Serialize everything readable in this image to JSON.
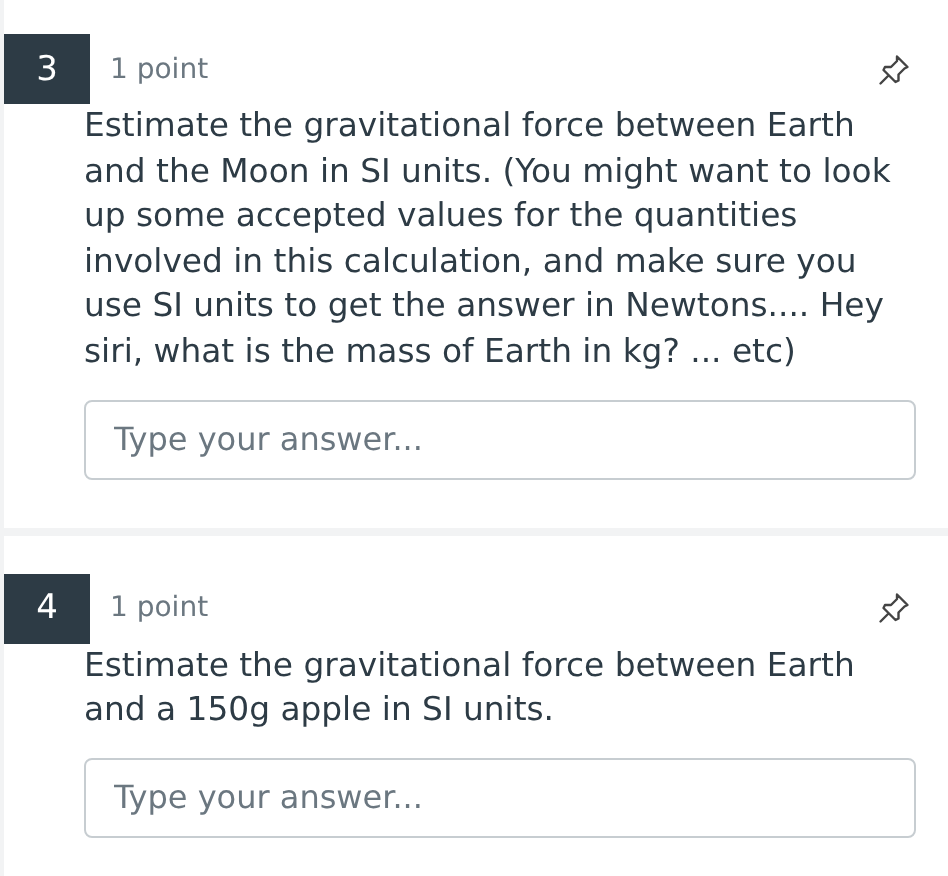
{
  "questions": [
    {
      "number": "3",
      "points": "1 point",
      "pinned": false,
      "text": "Estimate the gravitational force between Earth and the Moon in SI units. (You might want to look up some accepted values for the quantities involved in this calculation, and make sure you use SI units to get the answer in Newtons.... Hey siri, what is the mass of Earth in kg? ... etc)",
      "answer": {
        "placeholder": "Type your answer..."
      }
    },
    {
      "number": "4",
      "points": "1 point",
      "pinned": false,
      "text": "Estimate the gravitational force between Earth and a 150g apple in SI units.",
      "answer": {
        "placeholder": "Type your answer..."
      }
    }
  ]
}
